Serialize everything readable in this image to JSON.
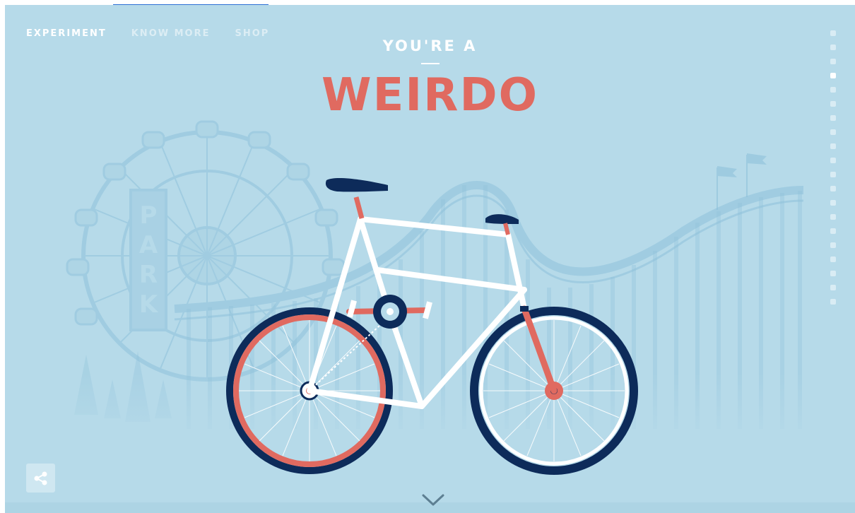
{
  "nav": {
    "items": [
      {
        "label": "EXPERIMENT",
        "active": true
      },
      {
        "label": "KNOW MORE",
        "active": false
      },
      {
        "label": "SHOP",
        "active": false
      }
    ]
  },
  "headline": {
    "subtitle": "YOU'RE A",
    "title": "WEIRDO"
  },
  "background": {
    "sign_text": "PARK"
  },
  "pagination": {
    "count": 20,
    "active_index": 3
  },
  "colors": {
    "background": "#b6dae9",
    "accent": "#e06a60",
    "navy": "#0d2b5a",
    "frame": "#ffffff",
    "silhouette": "#9fcbe0"
  },
  "icons": {
    "share": "share-icon",
    "scroll": "chevron-down-icon"
  }
}
